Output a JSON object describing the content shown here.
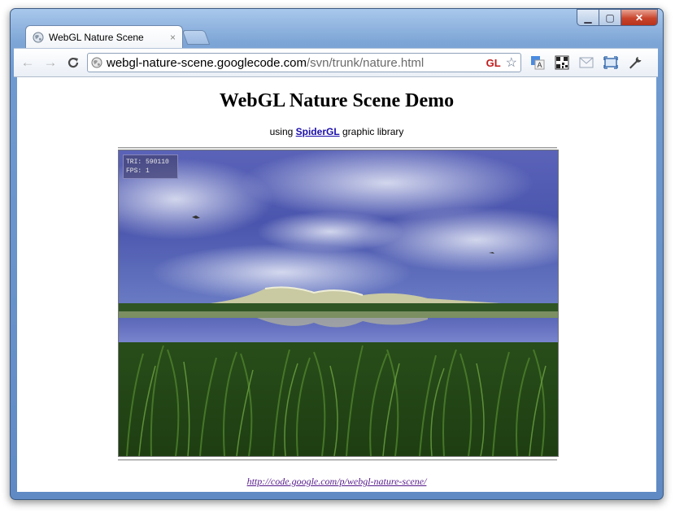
{
  "browser": {
    "tab_title": "WebGL Nature Scene",
    "tab_close": "×",
    "url_host": "webgl-nature-scene.googlecode.com",
    "url_path": "/svn/trunk/nature.html",
    "gl_badge": "GL",
    "back_icon": "←",
    "forward_icon": "→",
    "reload_icon": "C",
    "star_icon": "☆",
    "wrench_icon": "🔧",
    "window_controls": {
      "minimize": "▁",
      "maximize": "▢",
      "close": "✕"
    }
  },
  "page": {
    "title": "WebGL Nature Scene Demo",
    "subtitle_prefix": "using",
    "subtitle_link": "SpiderGL",
    "subtitle_suffix": "graphic library",
    "hud_tri": "TRI: 590110",
    "hud_fps": "FPS: 1",
    "footer_link": "http://code.google.com/p/webgl-nature-scene/"
  },
  "colors": {
    "sky_top": "#4a56a8",
    "water": "#6e78c8",
    "grass": "#2d5a1e",
    "link": "#1a0dab",
    "visited_link": "#551a8b",
    "gl_badge": "#c21b1b"
  }
}
